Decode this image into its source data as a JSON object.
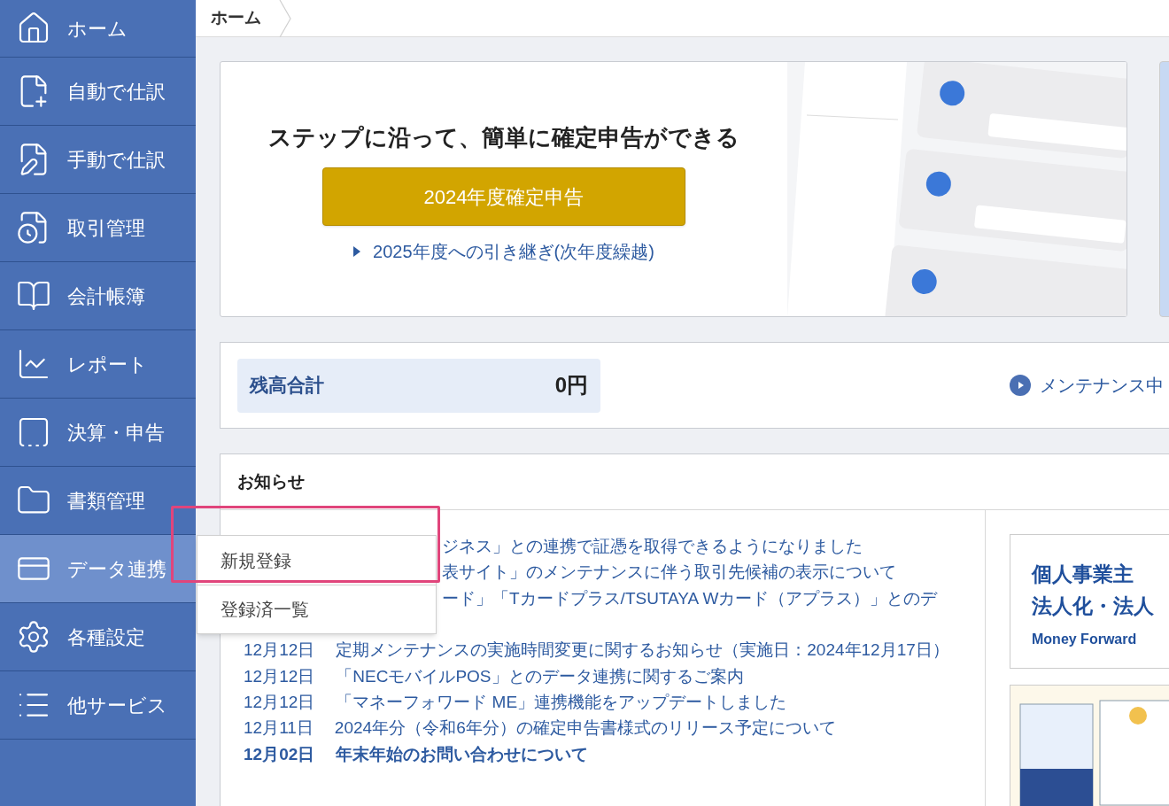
{
  "sidebar": {
    "items": [
      {
        "label": "ホーム",
        "selected": false
      },
      {
        "label": "自動で仕訳",
        "selected": false
      },
      {
        "label": "手動で仕訳",
        "selected": false
      },
      {
        "label": "取引管理",
        "selected": false
      },
      {
        "label": "会計帳簿",
        "selected": false
      },
      {
        "label": "レポート",
        "selected": false
      },
      {
        "label": "決算・申告",
        "selected": false
      },
      {
        "label": "書類管理",
        "selected": false
      },
      {
        "label": "データ連携",
        "selected": true
      },
      {
        "label": "各種設定",
        "selected": false
      },
      {
        "label": "他サービス",
        "selected": false
      }
    ]
  },
  "breadcrumb": [
    "ホーム"
  ],
  "hero": {
    "heading": "ステップに沿って、簡単に確定申告ができる",
    "button": "2024年度確定申告",
    "link": "2025年度への引き継ぎ(次年度繰越)"
  },
  "balance": {
    "label": "残高合計",
    "value": "0円",
    "link": "メンテナンス中"
  },
  "notices": {
    "title": "お知らせ",
    "items": [
      {
        "kind": "covered",
        "text": "ジネス」との連携で証憑を取得できるようになりました",
        "bold": false
      },
      {
        "kind": "covered",
        "text": "表サイト」のメンテナンスに伴う取引先候補の表示について",
        "bold": false
      },
      {
        "kind": "covered",
        "text": "ード」「Tカードプラス/TSUTAYA Wカード（アプラス）」とのデ",
        "bold": false
      },
      {
        "kind": "full",
        "date": "12月12日",
        "text": "定期メンテナンスの実施時間変更に関するお知らせ（実施日：2024年12月17日）",
        "bold": false
      },
      {
        "kind": "full",
        "date": "12月12日",
        "text": "「NECモバイルPOS」とのデータ連携に関するご案内",
        "bold": false
      },
      {
        "kind": "full",
        "date": "12月12日",
        "text": "「マネーフォワード ME」連携機能をアップデートしました",
        "bold": false
      },
      {
        "kind": "full",
        "date": "12月11日",
        "text": "2024年分（令和6年分）の確定申告書様式のリリース予定について",
        "bold": false
      },
      {
        "kind": "full",
        "date": "12月02日",
        "text": "年末年始のお問い合わせについて",
        "bold": true
      }
    ]
  },
  "dropdown": {
    "items": [
      "新規登録",
      "登録済一覧"
    ]
  },
  "ads": [
    {
      "kind": "text",
      "lines": [
        "個人事業主",
        "法人化・法人"
      ],
      "brand": "Money Forward"
    },
    {
      "kind": "image"
    }
  ]
}
